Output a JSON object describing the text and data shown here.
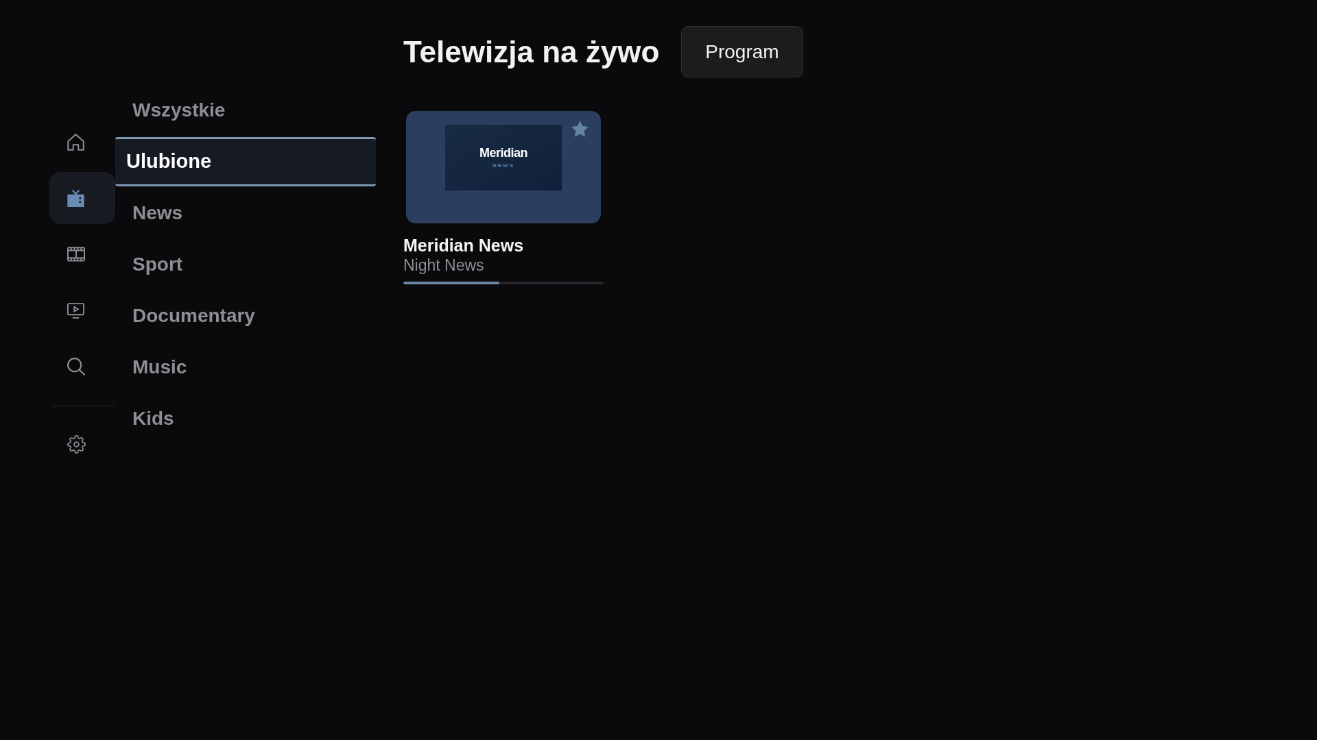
{
  "nav_rail": {
    "items": [
      {
        "selected": false
      },
      {
        "selected": true
      },
      {
        "selected": false
      },
      {
        "selected": false
      },
      {
        "selected": false
      }
    ],
    "settings": {
      "selected": false
    }
  },
  "categories": [
    {
      "label": "Wszystkie",
      "selected": false
    },
    {
      "label": "Ulubione",
      "selected": true
    },
    {
      "label": "News",
      "selected": false
    },
    {
      "label": "Sport",
      "selected": false
    },
    {
      "label": "Documentary",
      "selected": false
    },
    {
      "label": "Music",
      "selected": false
    },
    {
      "label": "Kids",
      "selected": false
    }
  ],
  "header": {
    "title": "Telewizja na żywo",
    "button": "Program"
  },
  "channels": [
    {
      "logo": {
        "title": "Meridian",
        "subtitle": "NEWS"
      },
      "favorite": true,
      "name": "Meridian News",
      "program": "Night News",
      "level": 0.48
    }
  ]
}
